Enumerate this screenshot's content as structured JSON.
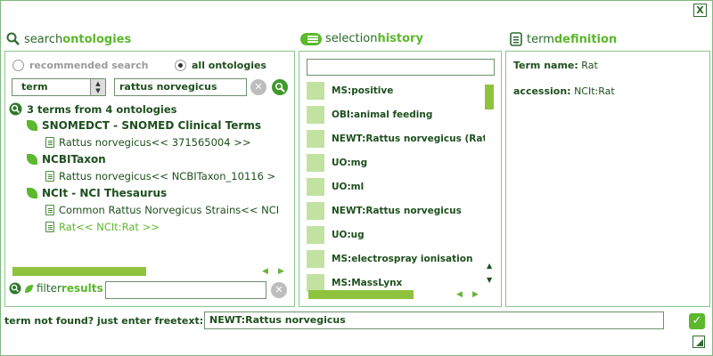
{
  "window": {
    "close_label": "X"
  },
  "search": {
    "title_part1": "search",
    "title_part2": "ontologies",
    "radio_recommended": "recommended search",
    "radio_all": "all ontologies",
    "field_select": "term",
    "query": "rattus norvegicus",
    "result_summary": "3 terms from 4 ontologies",
    "tree": [
      {
        "kind": "ontology",
        "label": "SNOMEDCT - SNOMED Clinical Terms"
      },
      {
        "kind": "term",
        "label": "Rattus norvegicus<< 371565004 >>"
      },
      {
        "kind": "ontology",
        "label": "NCBITaxon"
      },
      {
        "kind": "term",
        "label": "Rattus norvegicus<< NCBITaxon_10116 >"
      },
      {
        "kind": "ontology",
        "label": "NCIt - NCI Thesaurus"
      },
      {
        "kind": "term",
        "label": "Common Rattus Norvegicus Strains<< NCI"
      },
      {
        "kind": "term",
        "label": "Rat<< NCIt:Rat >>",
        "highlight": true
      }
    ],
    "filter_part1": "filter",
    "filter_part2": "results",
    "filter_value": ""
  },
  "history": {
    "title_part1": "selection",
    "title_part2": "history",
    "search_value": "",
    "items": [
      "MS:positive",
      "OBI:animal feeding",
      "NEWT:Rattus norvegicus (Rat)",
      "UO:mg",
      "UO:ml",
      "NEWT:Rattus norvegicus",
      "UO:ug",
      "MS:electrospray ionisation",
      "MS:MassLynx"
    ]
  },
  "definition": {
    "title_part1": "term",
    "title_part2": "definition",
    "name_label": "Term name:",
    "name_value": "Rat",
    "accession_label": "accession:",
    "accession_value": "NCIt:Rat"
  },
  "freetext": {
    "label": "term not found? just enter freetext:",
    "value": "NEWT:Rattus norvegicus"
  },
  "colors": {
    "accent": "#5cb82c",
    "dark": "#1e4f1e",
    "border": "#8cc48c"
  },
  "icons": [
    "close-icon",
    "search-icon",
    "history-icon",
    "definition-icon",
    "leaf-icon",
    "document-icon",
    "clear-icon",
    "checkmark-icon",
    "resize-icon"
  ]
}
